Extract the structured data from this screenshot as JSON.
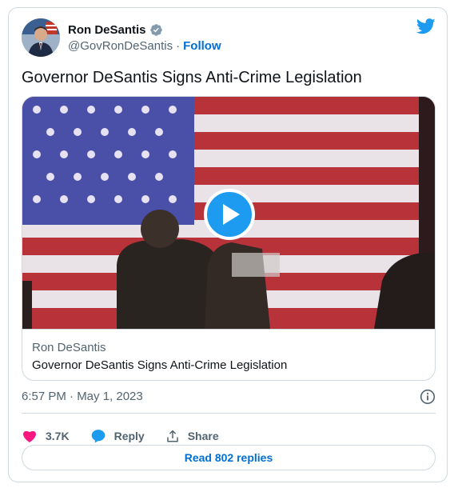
{
  "author": {
    "display_name": "Ron DeSantis",
    "handle": "@GovRonDeSantis",
    "separator": "·",
    "follow_label": "Follow",
    "verified_icon": "verified-badge-icon",
    "avatar": "avatar"
  },
  "tweet": {
    "text": "Governor DeSantis Signs Anti-Crime Legislation"
  },
  "media": {
    "play_icon": "play-icon",
    "site": "Ron DeSantis",
    "title": "Governor DeSantis Signs Anti-Crime Legislation"
  },
  "meta": {
    "timestamp": "6:57 PM · May 1, 2023",
    "info_icon": "info-icon"
  },
  "actions": {
    "like_count": "3.7K",
    "reply_label": "Reply",
    "share_label": "Share"
  },
  "replies_button": "Read 802 replies",
  "colors": {
    "accent": "#1d9bf0",
    "link": "#006fd6",
    "like": "#f91880",
    "muted_text": "#536471",
    "border": "#cfd9de"
  }
}
